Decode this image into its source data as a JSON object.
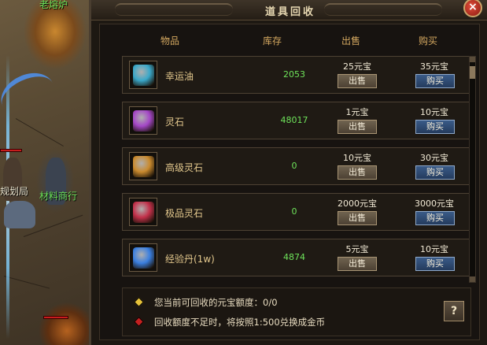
{
  "world": {
    "npc_top": "老熔炉",
    "npc_left_partial": "规划局",
    "npc_merchant": "材料商行"
  },
  "window": {
    "title": "道具回收",
    "close_label": "×"
  },
  "columns": {
    "item": "物品",
    "stock": "库存",
    "sell": "出售",
    "buy": "购买"
  },
  "items": [
    {
      "name": "幸运油",
      "stock": "2053",
      "sell_price": "25元宝",
      "sell_label": "出售",
      "buy_price": "35元宝",
      "buy_label": "购买",
      "icon": "potion-icon",
      "color": "#3aa8c9"
    },
    {
      "name": "灵石",
      "stock": "48017",
      "sell_price": "1元宝",
      "sell_label": "出售",
      "buy_price": "10元宝",
      "buy_label": "购买",
      "icon": "purple-stone-icon",
      "color": "#a447c7"
    },
    {
      "name": "高级灵石",
      "stock": "0",
      "sell_price": "10元宝",
      "sell_label": "出售",
      "buy_price": "30元宝",
      "buy_label": "购买",
      "icon": "gold-stone-icon",
      "color": "#c98a2e"
    },
    {
      "name": "极品灵石",
      "stock": "0",
      "sell_price": "2000元宝",
      "sell_label": "出售",
      "buy_price": "3000元宝",
      "buy_label": "购买",
      "icon": "red-stone-icon",
      "color": "#c2304a"
    },
    {
      "name": "经验丹(1w)",
      "stock": "4874",
      "sell_price": "5元宝",
      "sell_label": "出售",
      "buy_price": "10元宝",
      "buy_label": "购买",
      "icon": "blue-orb-icon",
      "color": "#3a7fe0"
    }
  ],
  "info": {
    "line1": "您当前可回收的元宝额度：0/0",
    "line2": "回收额度不足时，将按照1:500兑换成金币",
    "help_label": "?",
    "diamond1_color": "#e6c23a",
    "diamond2_color": "#c42020"
  }
}
